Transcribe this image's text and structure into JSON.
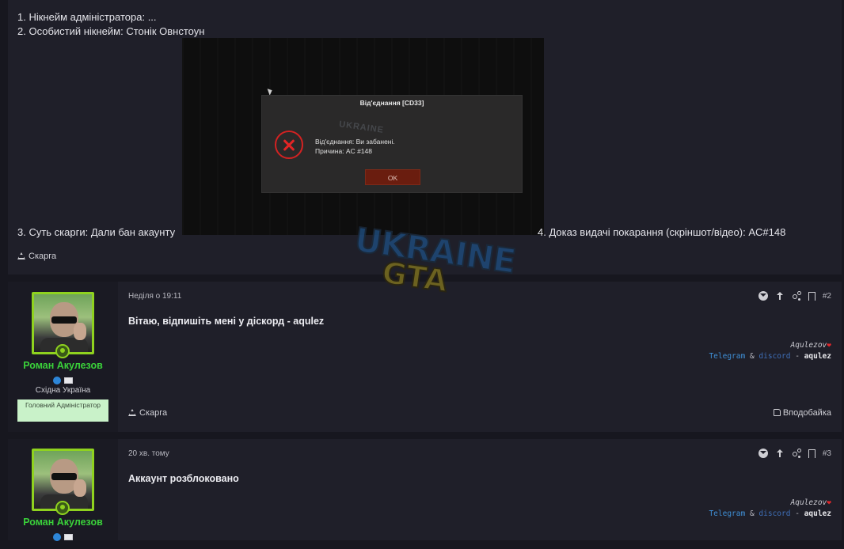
{
  "post1": {
    "line1": "1. Нікнейм адміністратора: ...",
    "line2": "2. Особистий нікнейм: Стонік Овнстоун",
    "line3": "3. Суть скарги: Дали бан акаунту",
    "line4": "4. Доказ видачі покарання (скріншот/відео): AC#148",
    "report_label": "Скарга",
    "screenshot": {
      "dialog_title": "Від'єднання [CD33]",
      "msg1": "Від'єднання: Ви забанені.",
      "msg2": "Причина: AC #148",
      "ok_label": "OK",
      "watermark_small": "UKRAINE"
    }
  },
  "watermark": {
    "top": "UKRAINE",
    "bottom": "GTA"
  },
  "posts": [
    {
      "date": "Неділя о 19:11",
      "number": "#2",
      "title": "Вітаю, відпишіть мені у діскорд - aqulez",
      "user": {
        "name": "Роман Акулезов",
        "region": "Східна Україна",
        "role": "Головний Адміністратор"
      },
      "sig": {
        "name": "Aqulezov",
        "heart": "❤",
        "telegram": "Telegram",
        "amp": "&",
        "discord": "discord",
        "dash": "-",
        "handle": "aqulez"
      },
      "report_label": "Скарга",
      "like_label": "Вподобайка"
    },
    {
      "date": "20 хв. тому",
      "number": "#3",
      "title": "Аккаунт розблоковано",
      "user": {
        "name": "Роман Акулезов"
      },
      "sig": {
        "name": "Aqulezov",
        "heart": "❤",
        "telegram": "Telegram",
        "amp": "&",
        "discord": "discord",
        "dash": "-",
        "handle": "aqulez"
      }
    }
  ],
  "colors": {
    "background": "#17171f",
    "panel": "#1f1f29",
    "username": "#3ad13a",
    "avatar_border": "#8fd21f",
    "role_badge": "#c9f2c9",
    "link_blue": "#3f8fd6",
    "heart": "#e0262b"
  }
}
